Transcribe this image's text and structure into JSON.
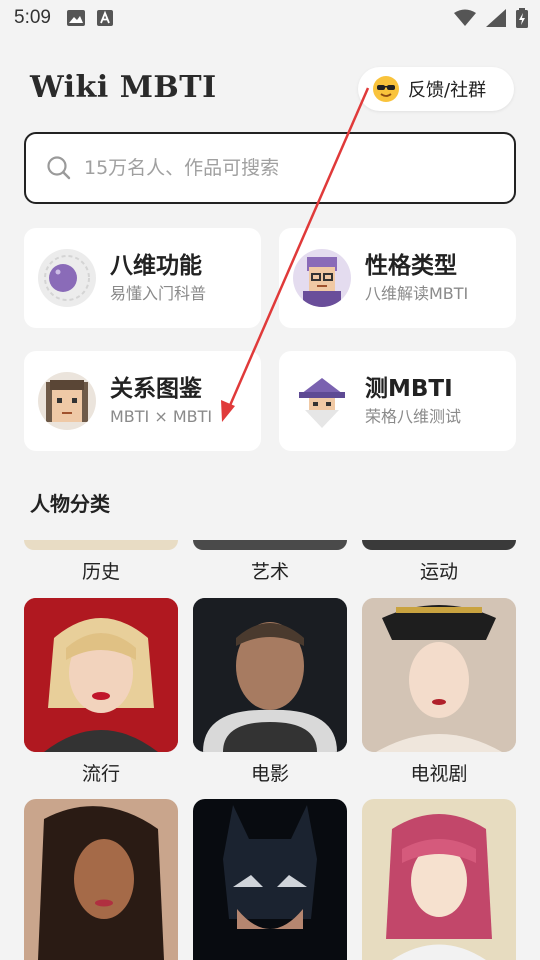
{
  "status": {
    "time": "5:09"
  },
  "header": {
    "app_title": "Wiki MBTI",
    "feedback_label": "反馈/社群"
  },
  "search": {
    "placeholder": "15万名人、作品可搜索"
  },
  "cards": [
    {
      "title": "八维功能",
      "subtitle": "易懂入门科普",
      "icon": "eight-functions-icon"
    },
    {
      "title": "性格类型",
      "subtitle": "八维解读MBTI",
      "icon": "personality-types-icon"
    },
    {
      "title": "关系图鉴",
      "subtitle": "MBTI × MBTI",
      "icon": "relationship-icon"
    },
    {
      "title": "测MBTI",
      "subtitle": "荣格八维测试",
      "icon": "test-mbti-icon"
    }
  ],
  "categories_section": {
    "title": "人物分类",
    "items": [
      {
        "label": "历史"
      },
      {
        "label": "艺术"
      },
      {
        "label": "运动"
      },
      {
        "label": "流行"
      },
      {
        "label": "电影"
      },
      {
        "label": "电视剧"
      },
      {
        "label": ""
      },
      {
        "label": ""
      },
      {
        "label": ""
      }
    ]
  },
  "colors": {
    "background": "#f3f3f3",
    "card": "#ffffff",
    "accent_arrow": "#e03a3a",
    "purple": "#8a6bb8"
  }
}
